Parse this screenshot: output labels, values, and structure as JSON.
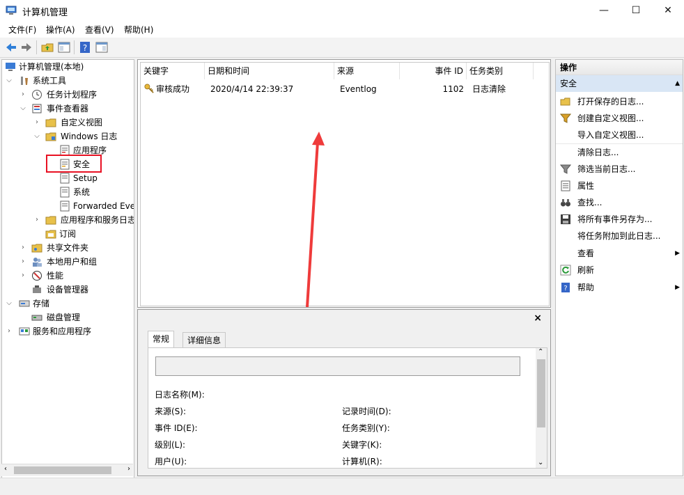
{
  "window": {
    "title": "计算机管理",
    "controls": {
      "minimize": "—",
      "maximize": "☐",
      "close": "✕"
    }
  },
  "menubar": [
    "文件(F)",
    "操作(A)",
    "查看(V)",
    "帮助(H)"
  ],
  "tree": {
    "root": "计算机管理(本地)",
    "system_tools": "系统工具",
    "task_scheduler": "任务计划程序",
    "event_viewer": "事件查看器",
    "custom_views": "自定义视图",
    "windows_logs": "Windows 日志",
    "application": "应用程序",
    "security": "安全",
    "setup": "Setup",
    "system": "系统",
    "forwarded": "Forwarded Eve",
    "app_service_logs": "应用程序和服务日志",
    "subscriptions": "订阅",
    "shared_folders": "共享文件夹",
    "local_users": "本地用户和组",
    "performance": "性能",
    "device_manager": "设备管理器",
    "storage": "存储",
    "disk_management": "磁盘管理",
    "services_apps": "服务和应用程序"
  },
  "list": {
    "columns": [
      "关键字",
      "日期和时间",
      "来源",
      "事件 ID",
      "任务类别"
    ],
    "rows": [
      {
        "keyword": "审核成功",
        "datetime": "2020/4/14 22:39:37",
        "source": "Eventlog",
        "event_id": "1102",
        "category": "日志清除"
      }
    ]
  },
  "detail": {
    "close": "×",
    "tabs": [
      "常规",
      "详细信息"
    ],
    "fields": {
      "log_name": "日志名称(M):",
      "source": "来源(S):",
      "logged": "记录时间(D):",
      "event_id": "事件 ID(E):",
      "task_category": "任务类别(Y):",
      "level": "级别(L):",
      "keywords": "关键字(K):",
      "user": "用户(U):",
      "computer": "计算机(R):"
    }
  },
  "actions": {
    "header": "操作",
    "section": "安全",
    "items": [
      {
        "label": "打开保存的日志..."
      },
      {
        "label": "创建自定义视图..."
      },
      {
        "label": "导入自定义视图..."
      },
      {
        "label": "清除日志..."
      },
      {
        "label": "筛选当前日志..."
      },
      {
        "label": "属性"
      },
      {
        "label": "查找..."
      },
      {
        "label": "将所有事件另存为..."
      },
      {
        "label": "将任务附加到此日志..."
      },
      {
        "label": "查看"
      },
      {
        "label": "刷新"
      },
      {
        "label": "帮助"
      }
    ]
  },
  "colors": {
    "highlight_box": "#e81123",
    "annotation_arrow": "#ef3b3b",
    "actions_selected": "#d9e6f5"
  }
}
